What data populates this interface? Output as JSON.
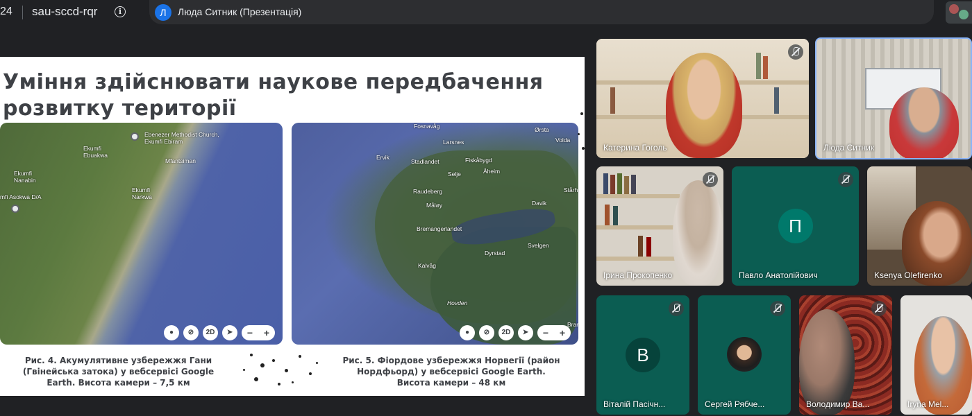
{
  "topbar": {
    "time": "24",
    "meeting_code": "sau-sccd-rqr",
    "presenter_initial": "Л",
    "presenter_label": "Люда Ситник (Презентація)"
  },
  "slide": {
    "title": "Уміння здійснювати наукове передбачення розвитку території",
    "map_left": {
      "places": [
        "Ebenezer Methodist Church, Ekumfi Ebiram",
        "Ekumfi Ebuakwa",
        "Mfantsiman",
        "Ekumfi Nanabin",
        "Ekumfi Narkwa",
        "mfi Asokwa D/A"
      ],
      "controls": [
        "2D",
        "−",
        "+"
      ]
    },
    "map_right": {
      "places": [
        "Fosnavåg",
        "Ørsta",
        "Larsnes",
        "Volda",
        "Ervik",
        "Stadlandet",
        "Fiskåbygd",
        "Selje",
        "Åheim",
        "Raudeberg",
        "Måløy",
        "Davik",
        "Stårh",
        "Bremangerlandet",
        "Svelgen",
        "Dyrstad",
        "Kalvåg",
        "Hovden",
        "Brar"
      ],
      "controls": [
        "2D",
        "−",
        "+"
      ]
    },
    "caption_left": "Рис. 4. Акумулятивне узбережжя Гани (Гвінейська затока) у вебсервісі Google Earth. Висота камери – 7,5 км",
    "caption_right": "Рис. 5. Фіордове узбережжя Норвегії (район Нордфьорд) у вебсервісі Google Earth. Висота камери – 48 км"
  },
  "participants": [
    {
      "name": "Катерина Гоголь",
      "muted": true
    },
    {
      "name": "Люда Ситник",
      "muted": false
    },
    {
      "name": "Ірина Прокопенко",
      "muted": true
    },
    {
      "name": "Павло Анатолійович",
      "initial": "П",
      "muted": true,
      "color": "#00796b"
    },
    {
      "name": "Ksenya Olefirenko",
      "muted": false
    },
    {
      "name": "Віталій Пасічн...",
      "initial": "В",
      "muted": true,
      "color": "#00796b"
    },
    {
      "name": "Сергей Рябче...",
      "muted": true
    },
    {
      "name": "Володимир Ва...",
      "muted": true
    },
    {
      "name": "Iryna Mel...",
      "muted": false
    }
  ],
  "colors": {
    "background": "#202124",
    "tile_teal": "#0b5d52",
    "avatar_teal": "#00796b",
    "active_speaker_border": "#8ab4f8"
  }
}
